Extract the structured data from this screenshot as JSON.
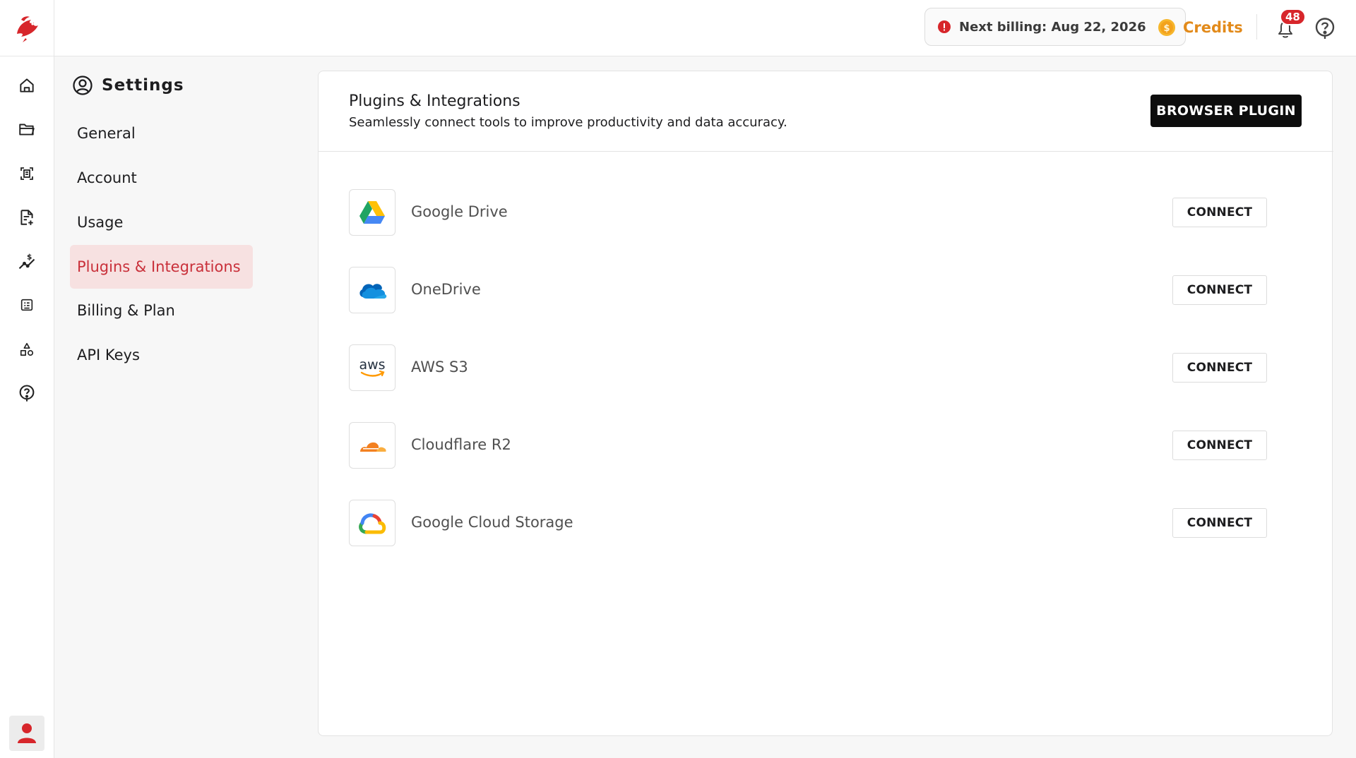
{
  "colors": {
    "brand_red": "#d7262b",
    "active_nav_bg": "#f7e1e1",
    "active_nav_text": "#c9303a",
    "credits_orange": "#e28a1a"
  },
  "rail": {
    "logo": "dragon-logo-icon",
    "items": [
      {
        "icon": "home-icon"
      },
      {
        "icon": "folder-icon"
      },
      {
        "icon": "scan-document-icon"
      },
      {
        "icon": "document-add-icon"
      },
      {
        "icon": "cost-analytics-icon"
      },
      {
        "icon": "form-list-icon"
      },
      {
        "icon": "shapes-icon"
      },
      {
        "icon": "help-icon"
      }
    ],
    "user_icon": "user-icon"
  },
  "topbar": {
    "billing_text": "Next billing: Aug 22, 2026",
    "credits_label": "Credits",
    "notification_count": "48"
  },
  "settings": {
    "title": "Settings",
    "nav": [
      {
        "label": "General"
      },
      {
        "label": "Account"
      },
      {
        "label": "Usage"
      },
      {
        "label": "Plugins & Integrations",
        "active": true
      },
      {
        "label": "Billing & Plan"
      },
      {
        "label": "API Keys"
      }
    ]
  },
  "main": {
    "title": "Plugins & Integrations",
    "subtitle": "Seamlessly connect tools to improve productivity and data accuracy.",
    "browser_plugin_label": "BROWSER PLUGIN",
    "integrations": [
      {
        "name": "Google Drive",
        "icon": "google-drive-icon",
        "button": "CONNECT"
      },
      {
        "name": "OneDrive",
        "icon": "onedrive-icon",
        "button": "CONNECT"
      },
      {
        "name": "AWS S3",
        "icon": "aws-icon",
        "logo_text": "aws",
        "button": "CONNECT"
      },
      {
        "name": "Cloudflare R2",
        "icon": "cloudflare-icon",
        "button": "CONNECT"
      },
      {
        "name": "Google Cloud Storage",
        "icon": "google-cloud-icon",
        "button": "CONNECT"
      }
    ]
  }
}
